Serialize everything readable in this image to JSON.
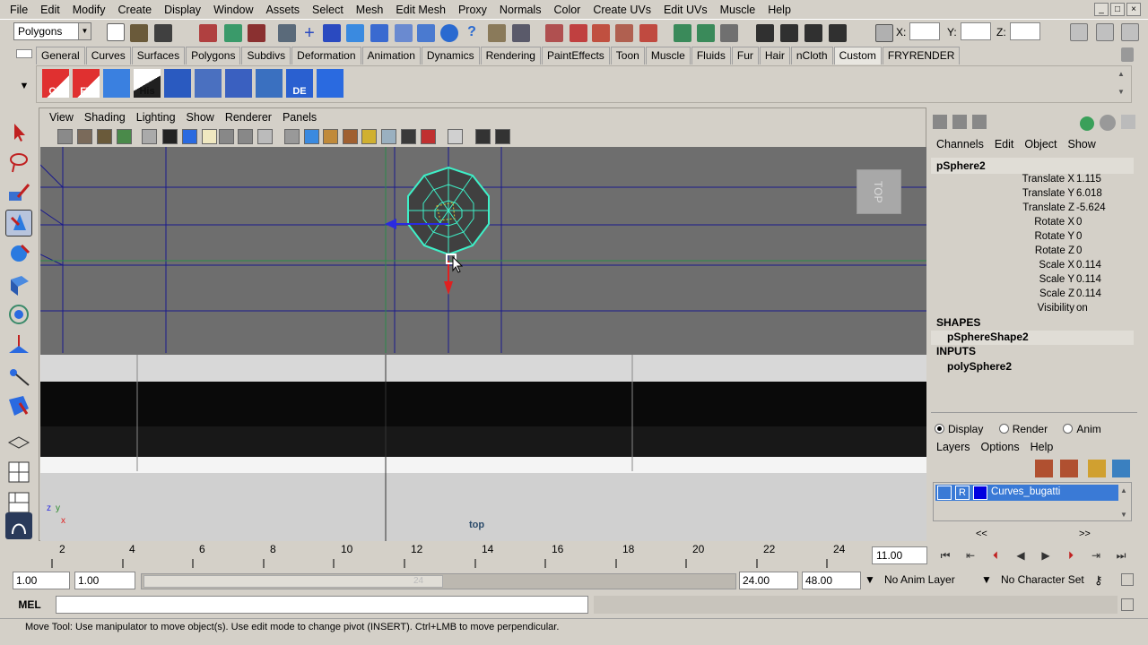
{
  "menus": [
    "File",
    "Edit",
    "Modify",
    "Create",
    "Display",
    "Window",
    "Assets",
    "Select",
    "Mesh",
    "Edit Mesh",
    "Proxy",
    "Normals",
    "Color",
    "Create UVs",
    "Edit UVs",
    "Muscle",
    "Help"
  ],
  "status": {
    "menu_set": "Polygons",
    "x_label": "X:",
    "y_label": "Y:",
    "z_label": "Z:"
  },
  "shelf_tabs": [
    "General",
    "Curves",
    "Surfaces",
    "Polygons",
    "Subdivs",
    "Deformation",
    "Animation",
    "Dynamics",
    "Rendering",
    "PaintEffects",
    "Toon",
    "Muscle",
    "Fluids",
    "Fur",
    "Hair",
    "nCloth",
    "Custom",
    "FRYRENDER"
  ],
  "active_shelf_tab": "Custom",
  "shelf_buttons": [
    "CP",
    "FT",
    "",
    "His",
    "",
    "",
    "",
    "",
    "DE",
    ""
  ],
  "panel_menus": [
    "View",
    "Shading",
    "Lighting",
    "Show",
    "Renderer",
    "Panels"
  ],
  "viewport": {
    "camera_label": "top",
    "view_cube": "TOP",
    "axis_y": "y",
    "axis_z": "z",
    "axis_x": "x"
  },
  "timeline": {
    "ticks": [
      "2",
      "4",
      "6",
      "8",
      "10",
      "12",
      "14",
      "16",
      "18",
      "20",
      "22",
      "24"
    ],
    "current_time": "11.00"
  },
  "range": {
    "start": "1.00",
    "playback_start": "1.00",
    "slider_end_label": "24",
    "playback_end": "24.00",
    "end": "48.00",
    "anim_layer": "No Anim Layer",
    "char_set": "No Character Set"
  },
  "cmd": {
    "label": "MEL"
  },
  "help_text": "Move Tool: Use manipulator to move object(s). Use edit mode to change pivot (INSERT).  Ctrl+LMB to move perpendicular.",
  "channel_box": {
    "menus": [
      "Channels",
      "Edit",
      "Object",
      "Show"
    ],
    "object": "pSphere2",
    "attrs": [
      {
        "label": "Translate X",
        "value": "1.115"
      },
      {
        "label": "Translate Y",
        "value": "6.018"
      },
      {
        "label": "Translate Z",
        "value": "-5.624"
      },
      {
        "label": "Rotate X",
        "value": "0"
      },
      {
        "label": "Rotate Y",
        "value": "0"
      },
      {
        "label": "Rotate Z",
        "value": "0"
      },
      {
        "label": "Scale X",
        "value": "0.114"
      },
      {
        "label": "Scale Y",
        "value": "0.114"
      },
      {
        "label": "Scale Z",
        "value": "0.114"
      },
      {
        "label": "Visibility",
        "value": "on"
      }
    ],
    "shapes_header": "SHAPES",
    "shape": "pSphereShape2",
    "inputs_header": "INPUTS",
    "input": "polySphere2"
  },
  "layer_editor": {
    "modes": [
      "Display",
      "Render",
      "Anim"
    ],
    "menus": [
      "Layers",
      "Options",
      "Help"
    ],
    "layer_r": "R",
    "layer_name": "Curves_bugatti",
    "nav_left": "<<",
    "nav_right": ">>"
  },
  "colors": {
    "ui_bg": "#d4d0c8",
    "viewport_bg": "#6e6e6e",
    "grid": "#1a1a8c",
    "selection": "#3a7ad6",
    "wire": "#3ef0c8"
  }
}
